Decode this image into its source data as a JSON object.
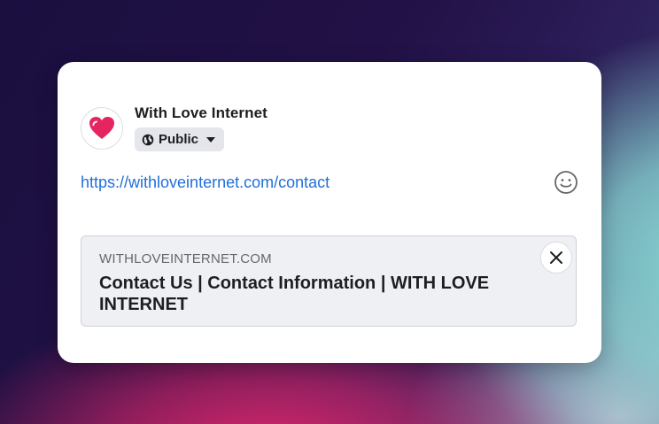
{
  "post": {
    "author": "With Love Internet",
    "privacy_label": "Public",
    "link_text": "https://withloveinternet.com/contact"
  },
  "link_preview": {
    "domain": "WITHLOVEINTERNET.COM",
    "title": "Contact Us | Contact Information | WITH LOVE INTERNET"
  },
  "icons": {
    "avatar": "heart-logo-icon",
    "privacy": "globe-icon",
    "privacy_menu": "caret-down-icon",
    "emoji": "smiley-icon",
    "close": "close-icon"
  },
  "colors": {
    "link": "#216fdb",
    "heart_logo": "#e5255f",
    "privacy_bg": "#e4e6eb",
    "preview_bg": "#eef0f3"
  }
}
